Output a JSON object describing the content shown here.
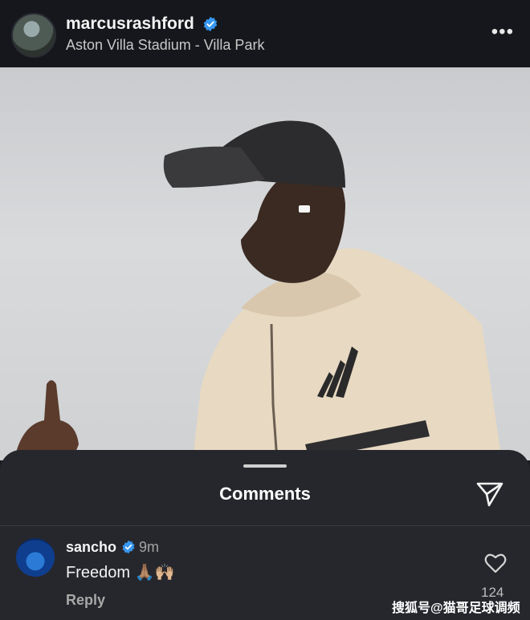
{
  "post": {
    "username": "marcusrashford",
    "location": "Aston Villa Stadium - Villa Park",
    "more_icon": "more-horizontal-icon"
  },
  "comments_sheet": {
    "title": "Comments",
    "share_icon": "send-icon",
    "comment": {
      "username": "sancho",
      "time": "9m",
      "text": "Freedom 🙏🏽🙌🏼",
      "reply_label": "Reply",
      "like_count": "124",
      "like_icon": "heart-outline-icon"
    }
  },
  "watermark": "搜狐号@猫哥足球调频",
  "colors": {
    "verified_blue": "#3897f0",
    "background": "#26272d",
    "header": "#15171c"
  }
}
